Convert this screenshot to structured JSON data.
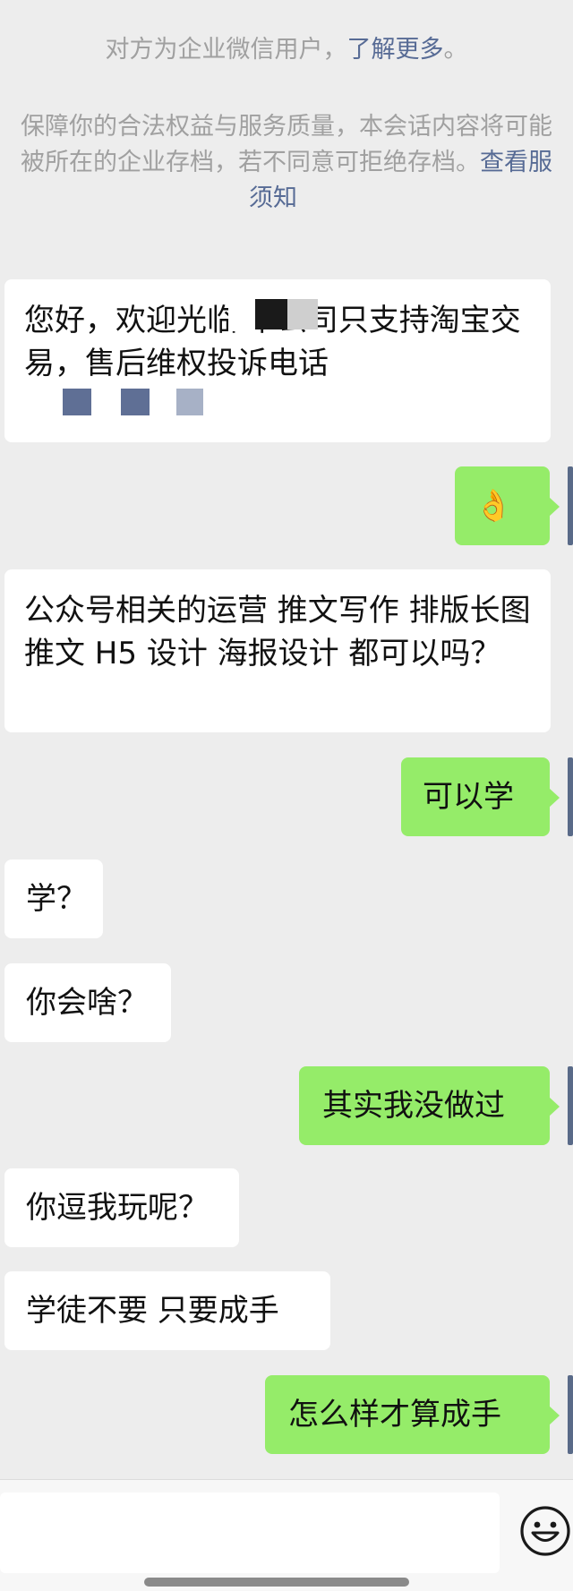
{
  "system_notice": {
    "line1_prefix": "对方为企业微信用户，",
    "line1_link": "了解更多",
    "line1_suffix": "。",
    "line2": "保障你的合法权益与服务质量，本会话内容将可能",
    "line3_text": "被所在的企业存档，若不同意可拒绝存档。",
    "line3_link": "查看服",
    "line4_link": "须知"
  },
  "messages": [
    {
      "side": "left",
      "text": "您好，欢迎光临      本公司只支持淘宝交易，售后维权投诉电话"
    },
    {
      "side": "right",
      "emoji": "👌",
      "icon": "ok-hand-emoji"
    },
    {
      "side": "left",
      "text": "公众号相关的运营 推文写作 排版长图推文 H5 设计 海报设计 都可以吗？"
    },
    {
      "side": "right",
      "text": "可以学"
    },
    {
      "side": "left",
      "text": "学？"
    },
    {
      "side": "left",
      "text": "你会啥？"
    },
    {
      "side": "right",
      "text": "其实我没做过"
    },
    {
      "side": "left",
      "text": "你逗我玩呢？"
    },
    {
      "side": "left",
      "text": "学徒不要 只要成手"
    },
    {
      "side": "right",
      "text": "怎么样才算成手"
    }
  ],
  "input_bar": {
    "emoji_button_icon": "smiley-face-icon"
  },
  "colors": {
    "background": "#ededed",
    "left_bubble": "#ffffff",
    "right_bubble": "#95ec69",
    "link": "#576b95",
    "notice_text": "#a0a0a0"
  }
}
